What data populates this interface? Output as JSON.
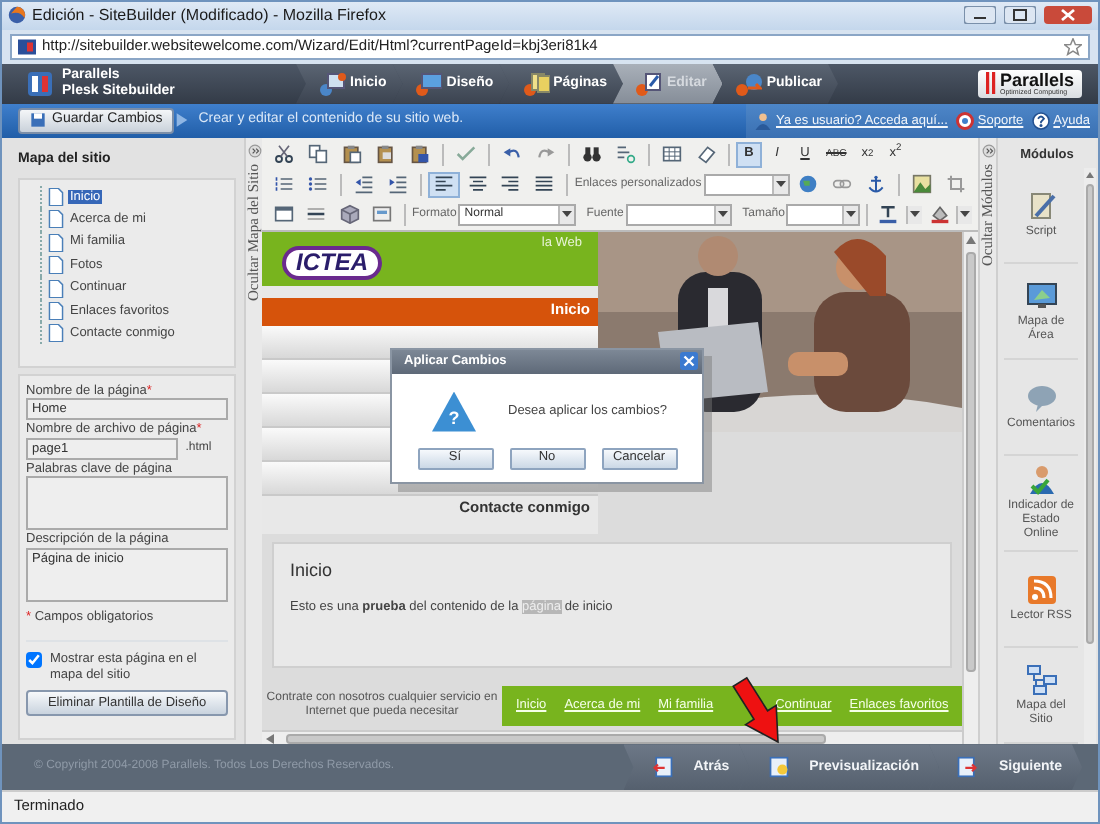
{
  "window": {
    "title": "Edición - SiteBuilder (Modificado) - Mozilla Firefox"
  },
  "address_bar": {
    "url": "http://sitebuilder.websitewelcome.com/Wizard/Edit/Html?currentPageId=kbj3eri81k4"
  },
  "app_header": {
    "product": [
      "Parallels",
      "Plesk Sitebuilder"
    ],
    "steps": [
      {
        "label": "Inicio",
        "selected": false
      },
      {
        "label": "Diseño",
        "selected": false
      },
      {
        "label": "Páginas",
        "selected": false
      },
      {
        "label": "Editar",
        "selected": true
      },
      {
        "label": "Publicar",
        "selected": false
      }
    ],
    "brand": {
      "name": "Parallels",
      "tagline": "Optimized Computing"
    }
  },
  "action_bar": {
    "save_button": "Guardar Cambios",
    "hint": "Crear y editar el contenido de su sitio web.",
    "links": [
      "Ya es usuario? Acceda aquí...",
      "Soporte",
      "Ayuda"
    ]
  },
  "site_map": {
    "title": "Mapa del sitio",
    "toggle": "Ocultar Mapa del Sitio",
    "pages": [
      {
        "label": "Inicio",
        "selected": true
      },
      {
        "label": "Acerca de mi",
        "selected": false
      },
      {
        "label": "Mi familia",
        "selected": false
      },
      {
        "label": "Fotos",
        "selected": false
      },
      {
        "label": "Continuar",
        "selected": false
      },
      {
        "label": "Enlaces favoritos",
        "selected": false
      },
      {
        "label": "Contacte conmigo",
        "selected": false
      }
    ]
  },
  "page_form": {
    "fields": [
      {
        "kind": "input",
        "label": "Nombre de la página",
        "mark": "*",
        "value": "Home"
      },
      {
        "kind": "input",
        "label": "Nombre de archivo de página",
        "mark": "*",
        "value": "page1",
        "suffix": ".html"
      },
      {
        "kind": "textarea",
        "label": "Palabras clave de página"
      },
      {
        "kind": "textarea",
        "label": "Descripción de la página",
        "value": "Página de inicio"
      }
    ],
    "required_note": {
      "mark": "*",
      "text": "Campos obligatorios"
    },
    "show_in_map": {
      "label": "Mostrar esta página en el mapa del sitio",
      "checked": true
    },
    "delete_button": "Eliminar Plantilla de Diseño"
  },
  "editor_toolbar": {
    "text_buttons": [
      {
        "label": "B",
        "on": true
      },
      {
        "label": "I",
        "on": false
      },
      {
        "label": "U",
        "on": false
      },
      {
        "label": "ABC",
        "on": false
      },
      {
        "label": "x$_{2}$",
        "on": false
      },
      {
        "label": "x$^{2}$",
        "on": false
      }
    ],
    "align_buttons": [
      {
        "on": true
      },
      {
        "on": false
      },
      {
        "on": false
      },
      {
        "on": false
      }
    ],
    "links_select": {
      "label": "Enlaces personalizados"
    },
    "format_select": {
      "label": "Formato",
      "value": "Normal"
    },
    "font_select": {
      "label": "Fuente"
    },
    "size_select": {
      "label": "Tamaño"
    }
  },
  "preview": {
    "logo_text": "ICTEA",
    "tagline": "la Web",
    "nav": [
      {
        "label": "Inicio",
        "selected": true
      },
      {
        "label": "Contacte conmigo",
        "selected": false
      }
    ],
    "content": {
      "heading": "Inicio",
      "text_parts": [
        {
          "text": "Esto es una **prueba** del contenido de la ",
          "selected": false
        },
        {
          "text": "página",
          "selected": true
        },
        {
          "text": "de inicio",
          "selected": false
        }
      ]
    },
    "footer": {
      "text": "Contrate con nosotros cualquier servicio en Internet que pueda necesitar",
      "links": [
        "Inicio",
        "Acerca de mi",
        "Mi familia",
        "Continuar",
        "Enlaces favoritos"
      ]
    }
  },
  "dialog": {
    "title": "Aplicar Cambios",
    "icon_glyph": "?",
    "message": "Desea aplicar los cambios?",
    "buttons": [
      "Sí",
      "No",
      "Cancelar"
    ]
  },
  "modules": {
    "title": "Módulos",
    "toggle": "Ocultar Módulos",
    "items": [
      "Script",
      "Mapa de Área",
      "Comentarios",
      "Indicador de Estado Online",
      "Lector RSS",
      "Mapa del Sitio"
    ]
  },
  "wizard_footer": {
    "copyright": "© Copyright 2004-2008 Parallels. Todos Los Derechos Reservados.",
    "buttons": [
      "Atrás",
      "Previsualización",
      "Siguiente"
    ]
  },
  "status_bar": {
    "text": "Terminado"
  }
}
